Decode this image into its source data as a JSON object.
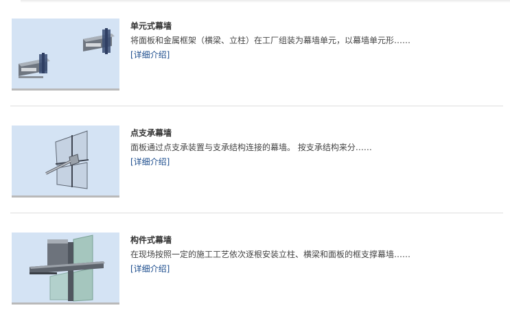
{
  "items": [
    {
      "title": "单元式幕墙",
      "description": "将面板和金属框架（横梁、立柱）在工厂组装为幕墙单元，以幕墙单元形……",
      "link": "[详细介绍]",
      "image_icon": "unit-curtain-wall-image"
    },
    {
      "title": "点支承幕墙",
      "description": "面板通过点支承装置与支承结构连接的幕墙。  按支承结构来分……",
      "link": "[详细介绍]",
      "image_icon": "point-supported-curtain-wall-image"
    },
    {
      "title": "构件式幕墙",
      "description": "在现场按照一定的施工工艺依次逐根安装立柱、横梁和面板的框支撑幕墙……",
      "link": "[详细介绍]",
      "image_icon": "stick-curtain-wall-image"
    }
  ],
  "colors": {
    "thumb_bg": "#d4e3f4",
    "link": "#1a4b8c",
    "divider": "#dcdcdc"
  }
}
